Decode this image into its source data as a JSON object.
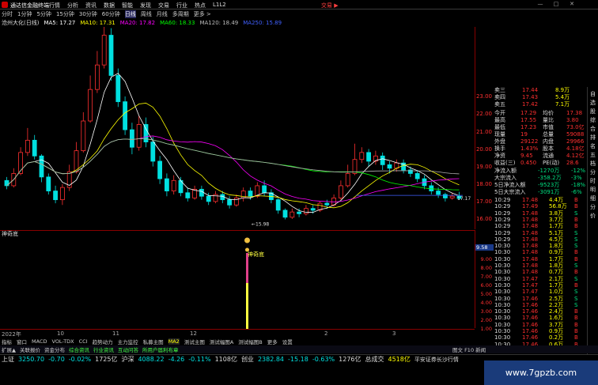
{
  "titlebar": {
    "app_title": "通达信金融终端",
    "menu": [
      "行情",
      "分析",
      "资讯",
      "数据",
      "智能",
      "发现",
      "交易",
      "行业",
      "热点",
      "L1L2"
    ],
    "trade_label": "交易 ▶"
  },
  "periods": [
    "分时",
    "1分钟",
    "5分钟",
    "15分钟",
    "30分钟",
    "60分钟",
    "日线",
    "周线",
    "月线",
    "多周期",
    "更多 >"
  ],
  "active_period": "日线",
  "ma_bar": {
    "stock": "沧州大化(日线)",
    "ma5": "MA5: 17.27",
    "ma10": "MA10: 17.31",
    "ma20": "MA20: 17.82",
    "ma60": "MA60: 18.33",
    "ma120": "MA120: 18.49",
    "ma250": "MA250: 15.89",
    "colors": {
      "ma5": "#ffffff",
      "ma10": "#ffff00",
      "ma20": "#ff00ff",
      "ma60": "#00ff00",
      "ma120": "#b0b0b0",
      "ma250": "#4060ff"
    }
  },
  "price_axis": [
    "23.00",
    "22.00",
    "21.00",
    "20.00",
    "19.00",
    "18.00",
    "17.00",
    "16.00"
  ],
  "price_labels": {
    "high": "28.88",
    "low": "15.98",
    "last": "17.17"
  },
  "indicator": {
    "title": "神奇底",
    "label": "神奇底",
    "axis": [
      "9.58",
      "9.00",
      "8.00",
      "7.00",
      "6.00",
      "5.00",
      "4.00",
      "3.00",
      "2.00",
      "1.00"
    ]
  },
  "date_axis": [
    "2022年",
    "10",
    "11",
    "12",
    "2",
    "3"
  ],
  "tabs1": [
    "指标",
    "窗口",
    "MACD",
    "VOL-TDX",
    "CCI",
    "趋势动力",
    "主力监控",
    "私募主图",
    "MA2",
    "测试主图",
    "测试幅图A",
    "测试幅图B",
    "更多",
    "设置"
  ],
  "tabs2": [
    "扩展▲",
    "关联报价",
    "资金分布",
    "综合资讯",
    "行业资讯",
    "互动问答",
    "所用户届利布章"
  ],
  "tabs2_right": "图文 F10 新闻",
  "status": [
    {
      "name": "上证",
      "value": "3250.70",
      "chg": "-0.70",
      "pct": "-0.02%",
      "amt": "1725亿"
    },
    {
      "name": "沪深",
      "value": "4088.22",
      "chg": "-4.26",
      "pct": "-0.11%",
      "amt": "1108亿"
    },
    {
      "name": "创业",
      "value": "2382.84",
      "chg": "-15.18",
      "pct": "-0.63%",
      "amt": "1276亿"
    },
    {
      "name": "总成交",
      "value": "4518亿",
      "chg": "",
      "pct": "",
      "amt": ""
    }
  ],
  "status_extra": "平安证券长沙行情",
  "watermark": "www.7gpzb.com",
  "quote_rows": [
    {
      "l": "卖三",
      "v": "17.44",
      "r": "8.9万"
    },
    {
      "l": "卖四",
      "v": "17.43",
      "r": "5.4万"
    },
    {
      "l": "卖五",
      "v": "17.42",
      "r": "7.1万"
    }
  ],
  "stats": [
    {
      "a": "今开",
      "b": "17.29",
      "c": "均价",
      "d": "17.38"
    },
    {
      "a": "最高",
      "b": "17.55",
      "c": "量比",
      "d": "3.80"
    },
    {
      "a": "最低",
      "b": "17.23",
      "c": "市值",
      "d": "73.0亿"
    },
    {
      "a": "现量",
      "b": "19",
      "c": "总量",
      "d": "59088"
    },
    {
      "a": "外盘",
      "b": "29122",
      "c": "内盘",
      "d": "29966"
    },
    {
      "a": "换手",
      "b": "1.43%",
      "c": "股本",
      "d": "4.18亿"
    },
    {
      "a": "净资",
      "b": "9.45",
      "c": "流通",
      "d": "4.12亿"
    },
    {
      "a": "收益(三)",
      "b": "0.450",
      "c": "PE(动)",
      "d": "28.6"
    }
  ],
  "flows": [
    {
      "a": "净流入额",
      "b": "-1270万",
      "c": "-12%"
    },
    {
      "a": "大宗流入",
      "b": "-358.2万",
      "c": "-3%"
    },
    {
      "a": "5日净流入额",
      "b": "-9523万",
      "c": "-18%"
    },
    {
      "a": "5日大宗流入",
      "b": "-3091万",
      "c": "-6%"
    }
  ],
  "ticks": [
    [
      "10:29",
      "17.48",
      "4.4万",
      "B"
    ],
    [
      "10:29",
      "17.49",
      "56.8万",
      "B"
    ],
    [
      "10:29",
      "17.48",
      "3.8万",
      "S"
    ],
    [
      "10:29",
      "17.48",
      "3.7万",
      "B"
    ],
    [
      "10:29",
      "17.48",
      "1.7万",
      "B"
    ],
    [
      "10:29",
      "17.48",
      "5.1万",
      "S"
    ],
    [
      "10:29",
      "17.48",
      "4.5万",
      "S"
    ],
    [
      "10:30",
      "17.48",
      "1.8万",
      "S"
    ],
    [
      "10:30",
      "17.48",
      "0.9万",
      "B"
    ],
    [
      "10:30",
      "17.48",
      "1.7万",
      "B"
    ],
    [
      "10:30",
      "17.48",
      "1.8万",
      "S"
    ],
    [
      "10:30",
      "17.48",
      "0.7万",
      "B"
    ],
    [
      "10:30",
      "17.47",
      "2.1万",
      "S"
    ],
    [
      "10:30",
      "17.47",
      "1.7万",
      "B"
    ],
    [
      "10:30",
      "17.47",
      "1.0万",
      "S"
    ],
    [
      "10:30",
      "17.46",
      "2.5万",
      "S"
    ],
    [
      "10:30",
      "17.46",
      "2.2万",
      "S"
    ],
    [
      "10:30",
      "17.46",
      "2.4万",
      "B"
    ],
    [
      "10:30",
      "17.46",
      "1.6万",
      "B"
    ],
    [
      "10:30",
      "17.46",
      "3.7万",
      "B"
    ],
    [
      "10:30",
      "17.46",
      "0.9万",
      "B"
    ],
    [
      "10:30",
      "17.46",
      "0.2万",
      "B"
    ],
    [
      "10:30",
      "17.46",
      "0.6万",
      "B"
    ],
    [
      "10:30",
      "17.46",
      "0.3万",
      "B"
    ],
    [
      "10:30",
      "17.46",
      "0.3万",
      "B"
    ]
  ],
  "sidestrip": [
    "自",
    "选",
    "股",
    "综",
    "合",
    "排",
    "名",
    "五",
    "档",
    "分",
    "时",
    "明",
    "细",
    "分",
    "价"
  ],
  "chart_data": {
    "type": "candlestick",
    "candles": [
      [
        18.2,
        17.9,
        18.4,
        17.7
      ],
      [
        17.9,
        18.6,
        18.9,
        17.8
      ],
      [
        18.6,
        19.8,
        20.1,
        18.5
      ],
      [
        19.8,
        20.5,
        21.2,
        19.6
      ],
      [
        20.5,
        19.6,
        20.8,
        19.4
      ],
      [
        19.6,
        18.4,
        19.7,
        18.1
      ],
      [
        18.4,
        17.6,
        18.6,
        17.4
      ],
      [
        17.6,
        17.1,
        17.9,
        16.9
      ],
      [
        17.1,
        17.8,
        18.0,
        16.8
      ],
      [
        17.8,
        18.7,
        19.1,
        17.6
      ],
      [
        18.7,
        19.9,
        20.4,
        18.6
      ],
      [
        19.9,
        21.6,
        22.1,
        19.8
      ],
      [
        21.6,
        23.4,
        24.2,
        21.5
      ],
      [
        23.4,
        24.8,
        25.6,
        23.2
      ],
      [
        24.8,
        26.5,
        28.88,
        24.6
      ],
      [
        26.5,
        24.2,
        26.9,
        23.9
      ],
      [
        24.2,
        22.7,
        24.6,
        22.4
      ],
      [
        22.7,
        21.1,
        23.0,
        20.8
      ],
      [
        21.1,
        20.1,
        21.5,
        19.7
      ],
      [
        20.1,
        21.4,
        21.9,
        19.9
      ],
      [
        21.4,
        20.4,
        21.8,
        20.1
      ],
      [
        20.4,
        19.3,
        20.7,
        19.0
      ],
      [
        19.3,
        18.3,
        19.6,
        18.0
      ],
      [
        18.3,
        17.6,
        18.6,
        17.3
      ],
      [
        17.6,
        18.2,
        18.5,
        17.4
      ],
      [
        18.2,
        17.5,
        18.4,
        17.3
      ],
      [
        17.5,
        17.2,
        17.8,
        17.0
      ],
      [
        17.2,
        17.7,
        17.9,
        17.1
      ],
      [
        17.7,
        17.3,
        17.9,
        17.1
      ],
      [
        17.3,
        17.0,
        17.5,
        16.8
      ],
      [
        17.0,
        17.4,
        17.6,
        16.9
      ],
      [
        17.4,
        17.1,
        17.6,
        16.9
      ],
      [
        17.1,
        16.8,
        17.3,
        16.6
      ],
      [
        16.8,
        17.2,
        17.4,
        16.7
      ],
      [
        17.2,
        17.6,
        17.8,
        17.0
      ],
      [
        17.6,
        17.3,
        17.8,
        17.1
      ],
      [
        17.3,
        17.9,
        18.1,
        17.2
      ],
      [
        17.9,
        17.5,
        18.2,
        17.3
      ],
      [
        17.5,
        17.1,
        17.7,
        16.9
      ],
      [
        17.1,
        16.5,
        17.2,
        16.3
      ],
      [
        16.5,
        16.1,
        16.6,
        15.98
      ],
      [
        16.1,
        16.4,
        16.6,
        16.0
      ],
      [
        16.4,
        16.3,
        16.6,
        16.1
      ],
      [
        16.3,
        16.6,
        16.8,
        16.2
      ],
      [
        16.6,
        16.5,
        16.8,
        16.3
      ],
      [
        16.5,
        16.9,
        17.0,
        16.4
      ],
      [
        16.9,
        16.8,
        17.1,
        16.6
      ],
      [
        16.8,
        17.2,
        17.4,
        16.7
      ],
      [
        17.2,
        17.9,
        18.2,
        17.1
      ],
      [
        17.9,
        18.6,
        19.1,
        17.8
      ],
      [
        18.6,
        19.4,
        20.3,
        18.5
      ],
      [
        19.4,
        19.8,
        20.1,
        19.2
      ],
      [
        19.8,
        19.3,
        20.0,
        19.0
      ],
      [
        19.3,
        19.6,
        19.9,
        19.1
      ],
      [
        19.6,
        19.1,
        19.8,
        18.8
      ],
      [
        19.1,
        18.9,
        19.3,
        18.6
      ],
      [
        18.9,
        19.2,
        19.4,
        18.7
      ],
      [
        19.2,
        18.8,
        19.4,
        18.6
      ],
      [
        18.8,
        18.6,
        19.0,
        18.4
      ],
      [
        18.6,
        18.3,
        18.8,
        18.1
      ],
      [
        18.3,
        17.9,
        18.5,
        17.7
      ],
      [
        17.9,
        17.6,
        18.1,
        17.4
      ],
      [
        17.6,
        17.4,
        17.8,
        17.2
      ],
      [
        17.4,
        17.2,
        17.5,
        17.0
      ],
      [
        17.2,
        17.3,
        17.5,
        17.1
      ],
      [
        17.3,
        17.17,
        17.55,
        17.1
      ]
    ],
    "ylim": [
      15.0,
      29.5
    ]
  }
}
